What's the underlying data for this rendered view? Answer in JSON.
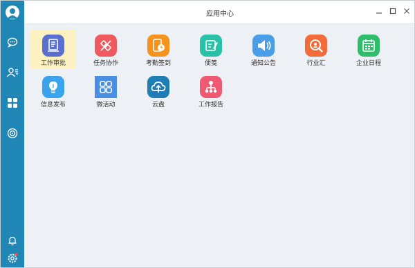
{
  "window": {
    "title": "应用中心"
  },
  "apps": [
    {
      "label": "工作审批",
      "icon": "approval-icon",
      "color": "#5b6fd1",
      "selected": true
    },
    {
      "label": "任务协作",
      "icon": "task-icon",
      "color": "#ee5a5d"
    },
    {
      "label": "考勤签到",
      "icon": "attendance-icon",
      "color": "#f6921e"
    },
    {
      "label": "便笺",
      "icon": "note-icon",
      "color": "#29c2a8"
    },
    {
      "label": "通知公告",
      "icon": "announcement-icon",
      "color": "#4a9ee8"
    },
    {
      "label": "行业汇",
      "icon": "industry-icon",
      "color": "#f26b3a"
    },
    {
      "label": "企业日程",
      "icon": "calendar-icon",
      "color": "#2ebd6b"
    },
    {
      "label": "信息发布",
      "icon": "publish-icon",
      "color": "#3aa3ee"
    },
    {
      "label": "微活动",
      "icon": "activity-icon",
      "color": "#4a90e2"
    },
    {
      "label": "云盘",
      "icon": "cloud-icon",
      "color": "#1e7db5"
    },
    {
      "label": "工作报告",
      "icon": "report-icon",
      "color": "#ef5a72"
    }
  ],
  "sidebar": {
    "items": [
      "chat-icon",
      "contacts-icon",
      "apps-icon",
      "discover-icon"
    ],
    "bottom": [
      "bell-icon",
      "settings-icon"
    ]
  }
}
